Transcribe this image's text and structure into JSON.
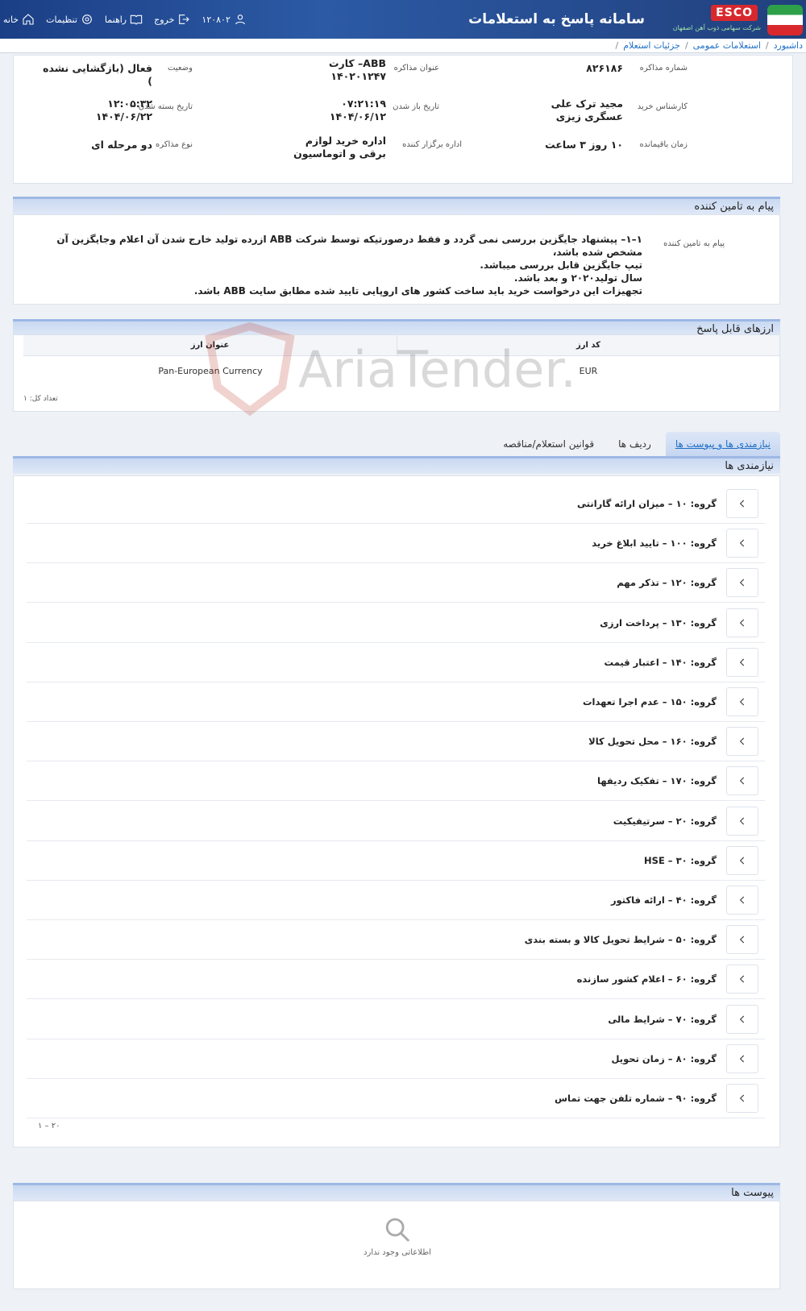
{
  "header": {
    "brand": "ESCO",
    "brand_sub": "شرکت سهامی ذوب آهن اصفهان",
    "app_title": "سامانه پاسخ به استعلامات",
    "nav": {
      "home": "خانه",
      "settings": "تنظیمات",
      "guide": "راهنما",
      "logout": "خروج",
      "user_id": "۱۲۰۸۰۲"
    }
  },
  "breadcrumb": [
    "داشبورد",
    "استعلامات عمومی",
    "جزئیات استعلام"
  ],
  "info": {
    "negotiation_number_label": "شماره مذاکره",
    "negotiation_number": "۸۲۶۱۸۶",
    "negotiation_title_label": "عنوان مذاکره",
    "negotiation_title": "ABB– کارت ۱۴۰۲۰۱۲۴۷",
    "status_label": "وضعیت",
    "status": "فعال (بازگشایی نشده )",
    "expert_label": "کارشناس خرید",
    "expert": "مجید ترک علی عسگری زیزی",
    "open_date_label": "تاریخ باز شدن",
    "open_date": "۰۷:۲۱:۱۹ ۱۴۰۴/۰۶/۱۲",
    "close_date_label": "تاریخ بسته شدن",
    "close_date": "۱۲:۰۵:۳۲ ۱۴۰۴/۰۶/۲۲",
    "remaining_label": "زمان باقیمانده",
    "remaining": "۱۰ روز ۳ ساعت",
    "organizer_label": "اداره برگزار کننده",
    "organizer": "اداره خرید لوازم برقی و اتوماسیون",
    "type_label": "نوع مذاکره",
    "type": "دو مرحله ای"
  },
  "supplier_message": {
    "section_title": "پیام به تامین کننده",
    "label": "پیام به تامین کننده",
    "lines": [
      "۱–۱– پیشنهاد جایگزین بررسی نمی گردد و فقط درصورتیکه توسط شرکت ABB ازرده تولید خارج شدن آن اعلام وجایگزین آن مشخص شده باشد،",
      "تیپ جایگزین قابل بررسی میباشد.",
      "سال تولید۲۰۲۰ و بعد باشد.",
      "تجهیزات این درخواست خرید باید ساخت کشور های اروپایی تایید شده مطابق سایت ABB باشد."
    ]
  },
  "currencies": {
    "section_title": "ارزهای قابل پاسخ",
    "columns": [
      "کد ارز",
      "عنوان ارز"
    ],
    "rows": [
      [
        "EUR",
        "Pan-European Currency"
      ]
    ],
    "count_label": "تعداد کل: ۱"
  },
  "watermark": "AriaTender.neT",
  "tabs": [
    "نیازمندی ها و پیوست ها",
    "ردیف ها",
    "قوانین استعلام/مناقصه"
  ],
  "requirements": {
    "section_title": "نیازمندی ها",
    "groups": [
      "گروه: ۱۰ – میزان ارائه گارانتی",
      "گروه: ۱۰۰ – تایید ابلاغ خرید",
      "گروه: ۱۲۰ – تذکر مهم",
      "گروه: ۱۳۰ – پرداخت ارزی",
      "گروه: ۱۴۰ – اعتبار قیمت",
      "گروه: ۱۵۰ – عدم اجرا تعهدات",
      "گروه: ۱۶۰ – محل تحویل کالا",
      "گروه: ۱۷۰ – تفکیک ردیفها",
      "گروه: ۲۰ – سرتیفیکیت",
      "گروه: ۳۰ – HSE",
      "گروه: ۴۰ – ارائه فاکتور",
      "گروه: ۵۰ – شرایط تحویل کالا و بسته بندی",
      "گروه: ۶۰ – اعلام کشور سازنده",
      "گروه: ۷۰ – شرایط مالی",
      "گروه: ۸۰ – زمان تحویل",
      "گروه: ۹۰ – شماره تلفن جهت تماس"
    ],
    "pager": "۱ – ۲۰"
  },
  "attachments": {
    "section_title": "پیوست ها",
    "empty_text": "اطلاعاتی وجود ندارد"
  }
}
